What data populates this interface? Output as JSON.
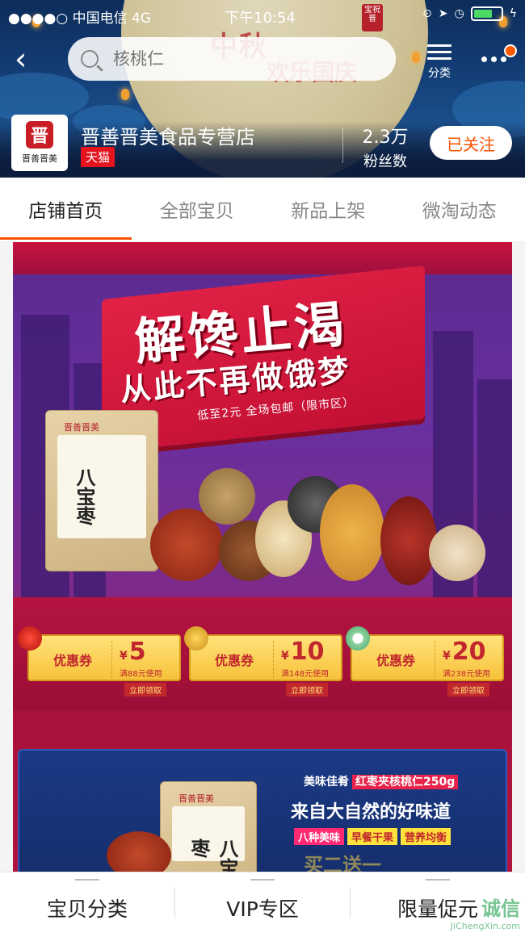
{
  "status_bar": {
    "carrier": "●●●●○ 中国电信  4G",
    "time": "下午10:54"
  },
  "header": {
    "search_placeholder": "核桃仁",
    "category_label": "分类",
    "banner_text_1": "中秋",
    "banner_text_2": "欢乐国庆",
    "seal_text": "宝祝普"
  },
  "store": {
    "logo_text": "晋善晋美",
    "logo_mark": "晋",
    "name": "晋善晋美食品专营店",
    "badge": "天猫",
    "fans_count": "2.3万",
    "fans_label": "粉丝数",
    "follow_label": "已关注"
  },
  "tabs": [
    {
      "label": "店铺首页",
      "active": true
    },
    {
      "label": "全部宝贝",
      "active": false
    },
    {
      "label": "新品上架",
      "active": false
    },
    {
      "label": "微淘动态",
      "active": false
    }
  ],
  "banner": {
    "slogan_main": "解馋止渴",
    "slogan_sub": "从此不再做饿梦",
    "slogan_small": "低至2元 全场包邮（限市区）",
    "bag_title": "八宝枣",
    "bag_brand": "晋善晋美",
    "coupons": [
      {
        "label": "优惠券",
        "amount": "5",
        "condition": "满88元使用",
        "action": "立即领取"
      },
      {
        "label": "优惠券",
        "amount": "10",
        "condition": "满148元使用",
        "action": "立即领取"
      },
      {
        "label": "优惠券",
        "amount": "20",
        "condition": "满238元使用",
        "action": "立即领取"
      }
    ],
    "currency": "¥",
    "promo": {
      "line1_prefix": "美味佳肴",
      "line1_highlight": "红枣夹核桃仁250g",
      "line2": "来自大自然的好味道",
      "tags": [
        "八种美味",
        "早餐干果",
        "营养均衡"
      ],
      "offer": "买二送一"
    }
  },
  "bottom_nav": [
    {
      "label": "宝贝分类"
    },
    {
      "label": "VIP专区"
    },
    {
      "label": "限量促元"
    }
  ],
  "watermark": {
    "text": "诚信",
    "sub": "JiChengXin.com"
  },
  "colors": {
    "accent": "#ff5000",
    "tmall": "#e5131e",
    "header_bg": "#123b72",
    "banner_red": "#c20f33"
  }
}
